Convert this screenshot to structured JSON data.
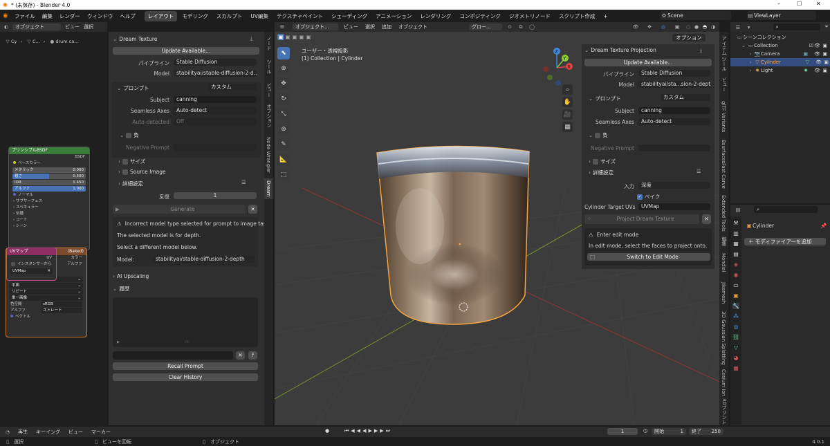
{
  "window": {
    "title": "* (未保存) - Blender 4.0",
    "controls": [
      "–",
      "☐",
      "✕"
    ]
  },
  "menubar": {
    "items": [
      "ファイル",
      "編集",
      "レンダー",
      "ウィンドウ",
      "ヘルプ"
    ],
    "workspaces": [
      "レイアウト",
      "モデリング",
      "スカルプト",
      "UV編集",
      "テクスチャペイント",
      "シェーディング",
      "アニメーション",
      "レンダリング",
      "コンポジティング",
      "ジオメトリノード",
      "スクリプト作成"
    ],
    "add_tab": "+",
    "scene": "Scene",
    "view_layer": "ViewLayer"
  },
  "node_editor": {
    "header": {
      "object_mode": "オブジェクト",
      "menus": [
        "ビュー",
        "選択",
        "追加",
        "ノード"
      ],
      "use_nodes": "ノードを使用",
      "slot": "スロット1",
      "material": "drum can"
    },
    "breadcrumb": [
      "Cy",
      "C...",
      "drum ca..."
    ],
    "principled": {
      "title": "プリンシプルBSDF",
      "output": "BSDF",
      "base_color": "ベースカラー",
      "fields": [
        {
          "label": "メタリック",
          "value": "0.000"
        },
        {
          "label": "粗さ",
          "value": "0.500"
        },
        {
          "label": "IOR",
          "value": "1.450"
        },
        {
          "label": "アルファ",
          "value": "1.000"
        }
      ],
      "sockets": [
        "ノーマル",
        "サブサーフェス",
        "スペキュラー",
        "伝播",
        "コート",
        "シーン",
        "放射"
      ]
    },
    "uvmap": {
      "title": "UVマップ",
      "output": "UV",
      "instancer": "インスタンサーから",
      "map": "UVMap"
    },
    "image": {
      "title_suffix": "(Baked)",
      "outputs": [
        "カラー",
        "アルファ"
      ],
      "settings": [
        "リニア",
        "平面",
        "リピート",
        "単一画像"
      ],
      "colorspace_label": "色空間",
      "colorspace": "sRGB",
      "alpha_label": "アルファ",
      "alpha": "ストレート",
      "vector": "ベクトル"
    }
  },
  "dream_texture": {
    "title": "Dream Texture",
    "update": "Update Available...",
    "pipeline_label": "パイプライン",
    "pipeline": "Stable Diffusion",
    "model_label": "Model",
    "model": "stabilityai/stable-diffusion-2-d...",
    "prompt_label": "プロンプト",
    "prompt_preset": "カスタム",
    "subject_label": "Subject",
    "subject": "canning",
    "seamless_label": "Seamless Axes",
    "seamless": "Auto-detect",
    "autodet_label": "Auto-detected",
    "autodet": "Off",
    "negative_label": "負",
    "negative_prompt_label": "Negative Prompt",
    "size_label": "サイズ",
    "source_image_label": "Source Image",
    "advanced_label": "詳細設定",
    "iterations_label": "反復",
    "iterations": "1",
    "generate": "Generate",
    "warning": "Incorrect model type selected for prompt to image tas...",
    "msg1": "The selected model is for depth.",
    "msg2": "Select a different model below.",
    "model2_label": "Model:",
    "model2": "stabilityai/stable-diffusion-2-depth",
    "upscaling": "AI Upscaling",
    "history": "履歴",
    "recall": "Recall Prompt",
    "clear": "Clear History"
  },
  "sidebar_tabs_left": [
    "ノード",
    "ツール",
    "ビュー",
    "オプション",
    "Node Wrangler",
    "Dream"
  ],
  "viewport": {
    "header": {
      "object_mode": "オブジェクト...",
      "menus": [
        "ビュー",
        "選択",
        "追加",
        "オブジェクト"
      ],
      "orient": "グロー...",
      "options": "オプション"
    },
    "info_line1": "ユーザー・透視投影",
    "info_line2": "(1) Collection | Cylinder",
    "gizmo_axes": [
      "X",
      "Y",
      "Z"
    ]
  },
  "projection": {
    "title": "Dream Texture Projection",
    "update": "Update Available...",
    "pipeline_label": "パイプライン",
    "pipeline": "Stable Diffusion",
    "model_label": "Model",
    "model": "stabilityai/sta...sion-2-depth",
    "prompt_label": "プロンプト",
    "prompt_preset": "カスタム",
    "subject_label": "Subject",
    "subject": "canning",
    "seamless_label": "Seamless Axes",
    "seamless": "Auto-detect",
    "negative_label": "負",
    "negative_prompt_label": "Negative Prompt",
    "size_label": "サイズ",
    "advanced_label": "詳細設定",
    "input_label": "入力",
    "input": "深度",
    "bake_label": "ベイク",
    "uvs_label": "Cylinder Target UVs",
    "uvs": "UVMap",
    "project": "Project Dream Texture",
    "warn_title": "Enter edit mode",
    "warn_msg": "In edit mode, select the faces to project onto.",
    "switch": "Switch to Edit Mode"
  },
  "sidebar_tabs_right": [
    "アイテム",
    "ツール",
    "ビュー",
    "glTF Variants",
    "Bsurfaces",
    "Fast Carve",
    "Extended Tools",
    "編集",
    "Mondial",
    "Jikemesh",
    "3D Gaussian Splatting",
    "Cesium Ion",
    "3Dプリント"
  ],
  "outliner": {
    "root": "シーンコレクション",
    "items": [
      {
        "name": "Collection",
        "depth": 1
      },
      {
        "name": "Camera",
        "depth": 2
      },
      {
        "name": "Cylinder",
        "depth": 2,
        "selected": true
      },
      {
        "name": "Light",
        "depth": 2
      }
    ]
  },
  "properties": {
    "object": "Cylinder",
    "add_modifier": "モディファイアーを追加"
  },
  "timeline": {
    "menus": [
      "再生",
      "キーイング",
      "ビュー",
      "マーカー"
    ],
    "frame": "1",
    "start_label": "開始",
    "start": "1",
    "end_label": "終了",
    "end": "250"
  },
  "statusbar": {
    "select": "選択",
    "rotate": "ビューを回転",
    "object": "オブジェクト",
    "version": "4.0.1"
  },
  "colors": {
    "accent": "#4772b3",
    "selected_outline": "#f5a442",
    "active": "#ffa64d"
  }
}
